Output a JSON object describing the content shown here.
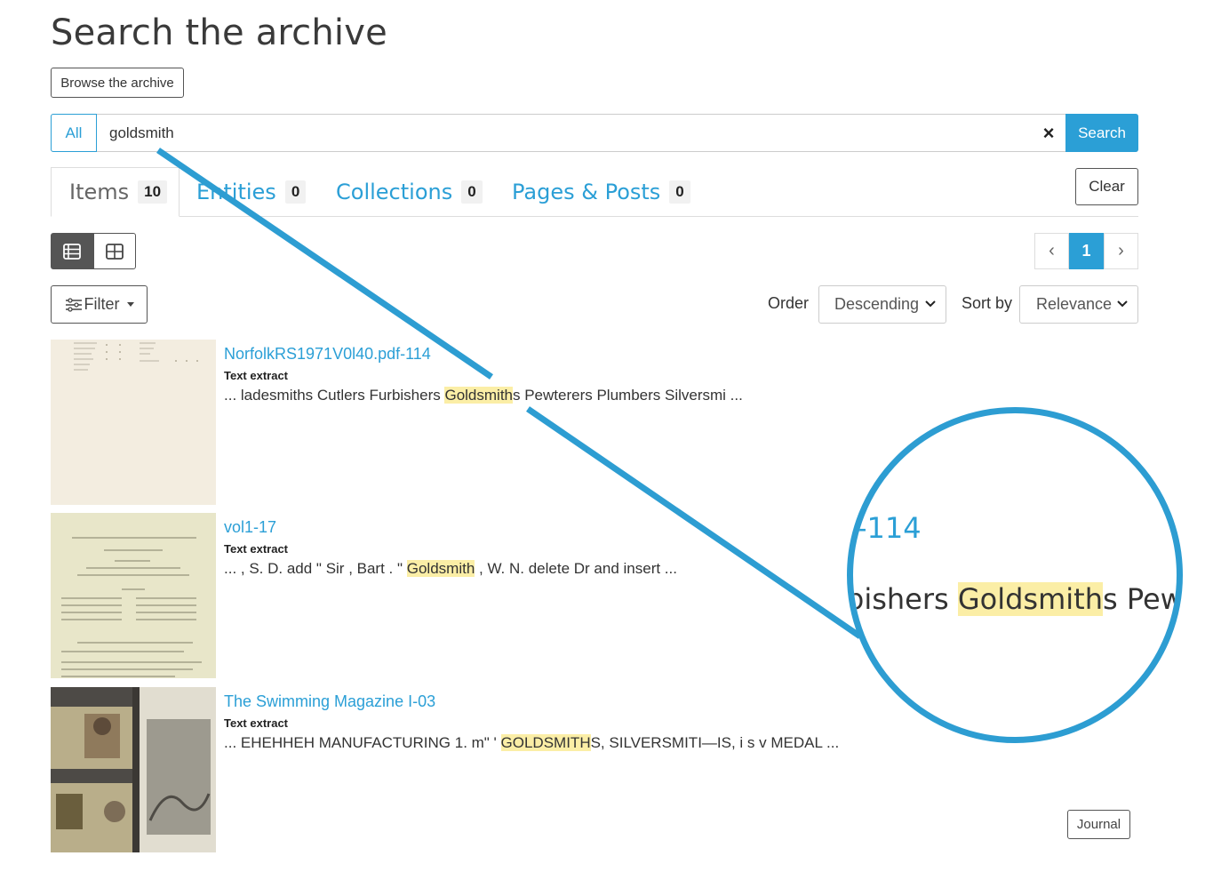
{
  "header": {
    "title": "Search the archive",
    "browse_label": "Browse the archive"
  },
  "search": {
    "scope": "All",
    "query": "goldsmith",
    "clear_icon": "×",
    "button_label": "Search"
  },
  "tabs": [
    {
      "label": "Items",
      "count": "10"
    },
    {
      "label": "Entities",
      "count": "0"
    },
    {
      "label": "Collections",
      "count": "0"
    },
    {
      "label": "Pages & Posts",
      "count": "0"
    }
  ],
  "toolbar": {
    "clear_label": "Clear",
    "list_view_icon": "list-icon",
    "grid_view_icon": "grid-icon",
    "filter_label": "Filter",
    "order_label": "Order",
    "order_value": "Descending",
    "sort_label": "Sort by",
    "sort_value": "Relevance"
  },
  "pagination": {
    "prev": "‹",
    "current": "1",
    "next": "›"
  },
  "results": [
    {
      "title": "NorfolkRS1971V0l40.pdf-114",
      "type": "Text extract",
      "pre": "... ladesmiths Cutlers Furbishers ",
      "hl": "Goldsmith",
      "post": "s Pewterers Plumbers Silversmi ..."
    },
    {
      "title": "vol1-17",
      "type": "Text extract",
      "pre": "... , S. D. add \" Sir , Bart . \" ",
      "hl": "Goldsmith",
      "post": " , W. N. delete Dr and insert ..."
    },
    {
      "title": "The Swimming Magazine I-03",
      "type": "Text extract",
      "pre": "... EHEHHEH MANUFACTURING 1. m\" ' ",
      "hl": "GOLDSMITH",
      "post": "S, SILVERSMITI—IS, i s v MEDAL ..."
    }
  ],
  "journal_badge": "Journal",
  "zoom": {
    "number": "-114",
    "pre": "bishers ",
    "hl": "Goldsmith",
    "post": "s Pewterers"
  },
  "colors": {
    "accent": "#2b9fd6",
    "highlight": "#fbeea6",
    "annotation": "#2d9dd2"
  }
}
